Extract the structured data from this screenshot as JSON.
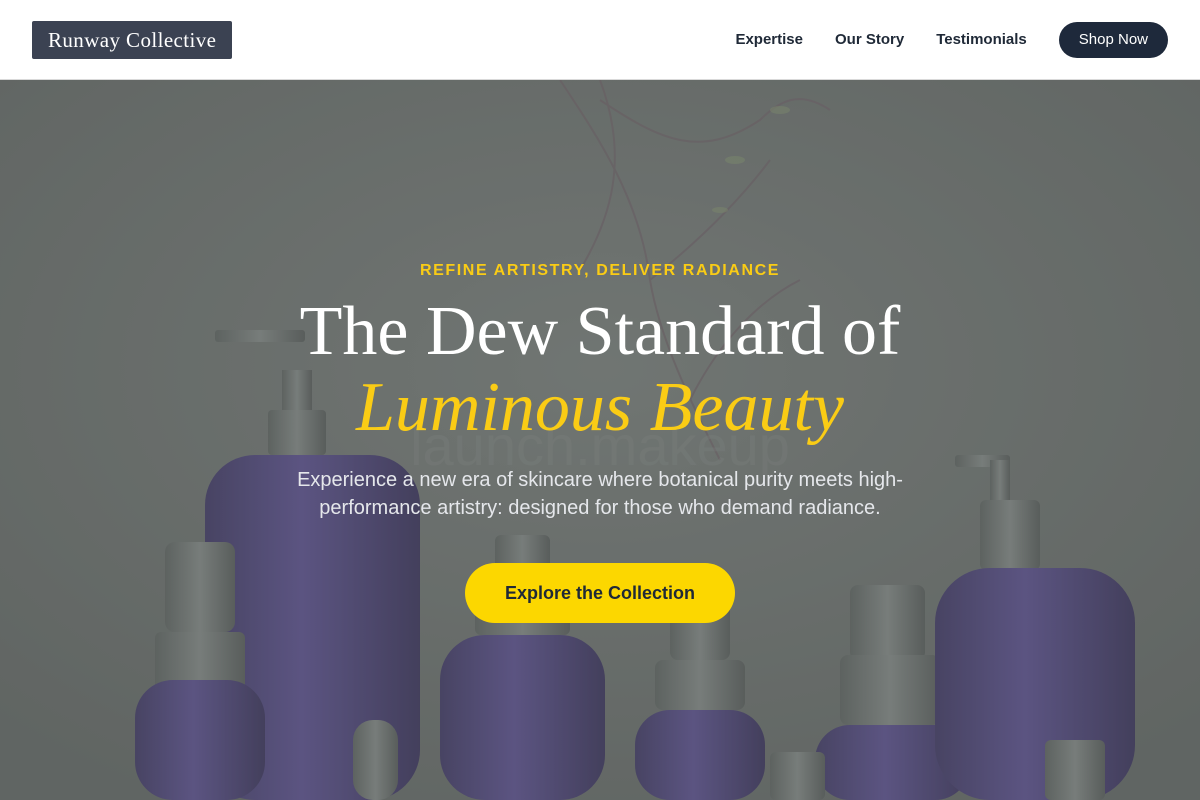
{
  "header": {
    "logo_text": "Runway Collective",
    "nav": [
      {
        "label": "Expertise"
      },
      {
        "label": "Our Story"
      },
      {
        "label": "Testimonials"
      }
    ],
    "cta_label": "Shop Now"
  },
  "hero": {
    "eyebrow": "REFINE ARTISTRY, DELIVER RADIANCE",
    "headline_line1": "The Dew Standard of",
    "headline_line2": "Luminous Beauty",
    "subtitle": "Experience a new era of skincare where botanical purity meets high-performance artistry: designed for those who demand radiance.",
    "button_label": "Explore the Collection",
    "background_watermark": "launch.makeup"
  },
  "colors": {
    "accent_yellow": "#facc15",
    "button_yellow": "#fcd700",
    "dark_navy": "#1e293b",
    "logo_bg": "#3b4252",
    "bottle_purple": "#4a3f7a"
  }
}
